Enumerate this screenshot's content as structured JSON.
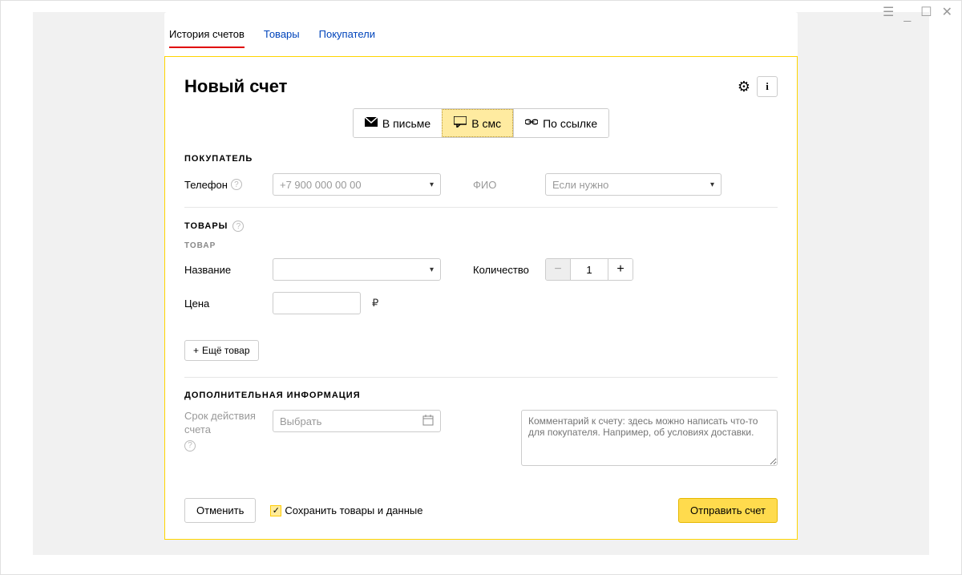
{
  "tabs": {
    "history": "История счетов",
    "goods": "Товары",
    "buyers": "Покупатели"
  },
  "title": "Новый счет",
  "modes": {
    "email": "В письме",
    "sms": "В смс",
    "link": "По ссылке"
  },
  "sections": {
    "buyer": "ПОКУПАТЕЛЬ",
    "goods": "ТОВАРЫ",
    "item": "ТОВАР",
    "extra": "ДОПОЛНИТЕЛЬНАЯ ИНФОРМАЦИЯ"
  },
  "labels": {
    "phone": "Телефон",
    "fio": "ФИО",
    "name": "Название",
    "qty": "Количество",
    "price": "Цена",
    "validity": "Срок действия счета",
    "currency": "₽"
  },
  "placeholders": {
    "phone": "+7 900 000 00 00",
    "fio": "Если нужно",
    "date": "Выбрать",
    "comment": "Комментарий к счету: здесь можно написать что-то для покупателя. Например, об условиях доставки."
  },
  "values": {
    "qty": "1"
  },
  "buttons": {
    "add_more": "Ещё товар",
    "cancel": "Отменить",
    "save_check": "Сохранить товары и данные",
    "send": "Отправить счет"
  }
}
